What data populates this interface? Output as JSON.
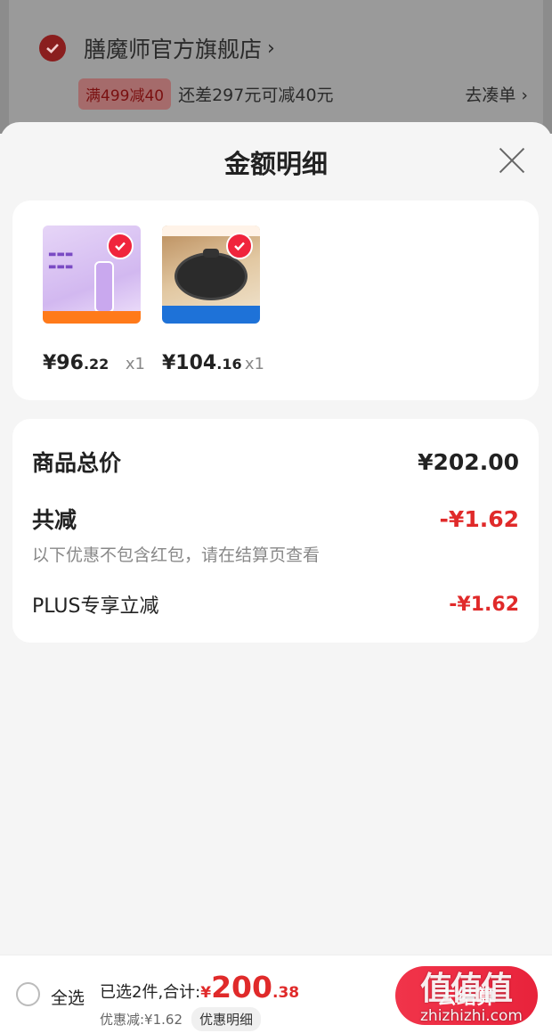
{
  "background_cart": {
    "store_name": "膳魔师官方旗舰店",
    "promo_tag": "满499减40",
    "promo_text": "还差297元可减40元",
    "promo_link": "去凑单"
  },
  "sheet": {
    "title": "金额明细",
    "products": [
      {
        "price_int": "¥96",
        "price_dec": ".22",
        "qty": "x1",
        "thumb_icon": "water-bottle-product-icon"
      },
      {
        "price_int": "¥104",
        "price_dec": ".16",
        "qty": "x1",
        "thumb_icon": "wok-pan-product-icon"
      }
    ],
    "summary": {
      "total_label": "商品总价",
      "total_value": "¥202.00",
      "reduce_label": "共减",
      "reduce_value": "-¥1.62",
      "note": "以下优惠不包含红包，请在结算页查看",
      "plus_label": "PLUS专享立减",
      "plus_value": "-¥1.62"
    }
  },
  "bottom_bar": {
    "select_all": "全选",
    "sum_label": "已选2件,合计:",
    "currency": "¥",
    "amount_int": "200",
    "amount_dec": ".38",
    "discount_text": "优惠减:¥1.62",
    "detail_button": "优惠明细",
    "checkout_button": "去结算",
    "watermark_logo": "值值值",
    "watermark_url": "zhizhizhi.com"
  },
  "colors": {
    "accent_red": "#e02a2a",
    "checkout_red": "#f0243c"
  }
}
